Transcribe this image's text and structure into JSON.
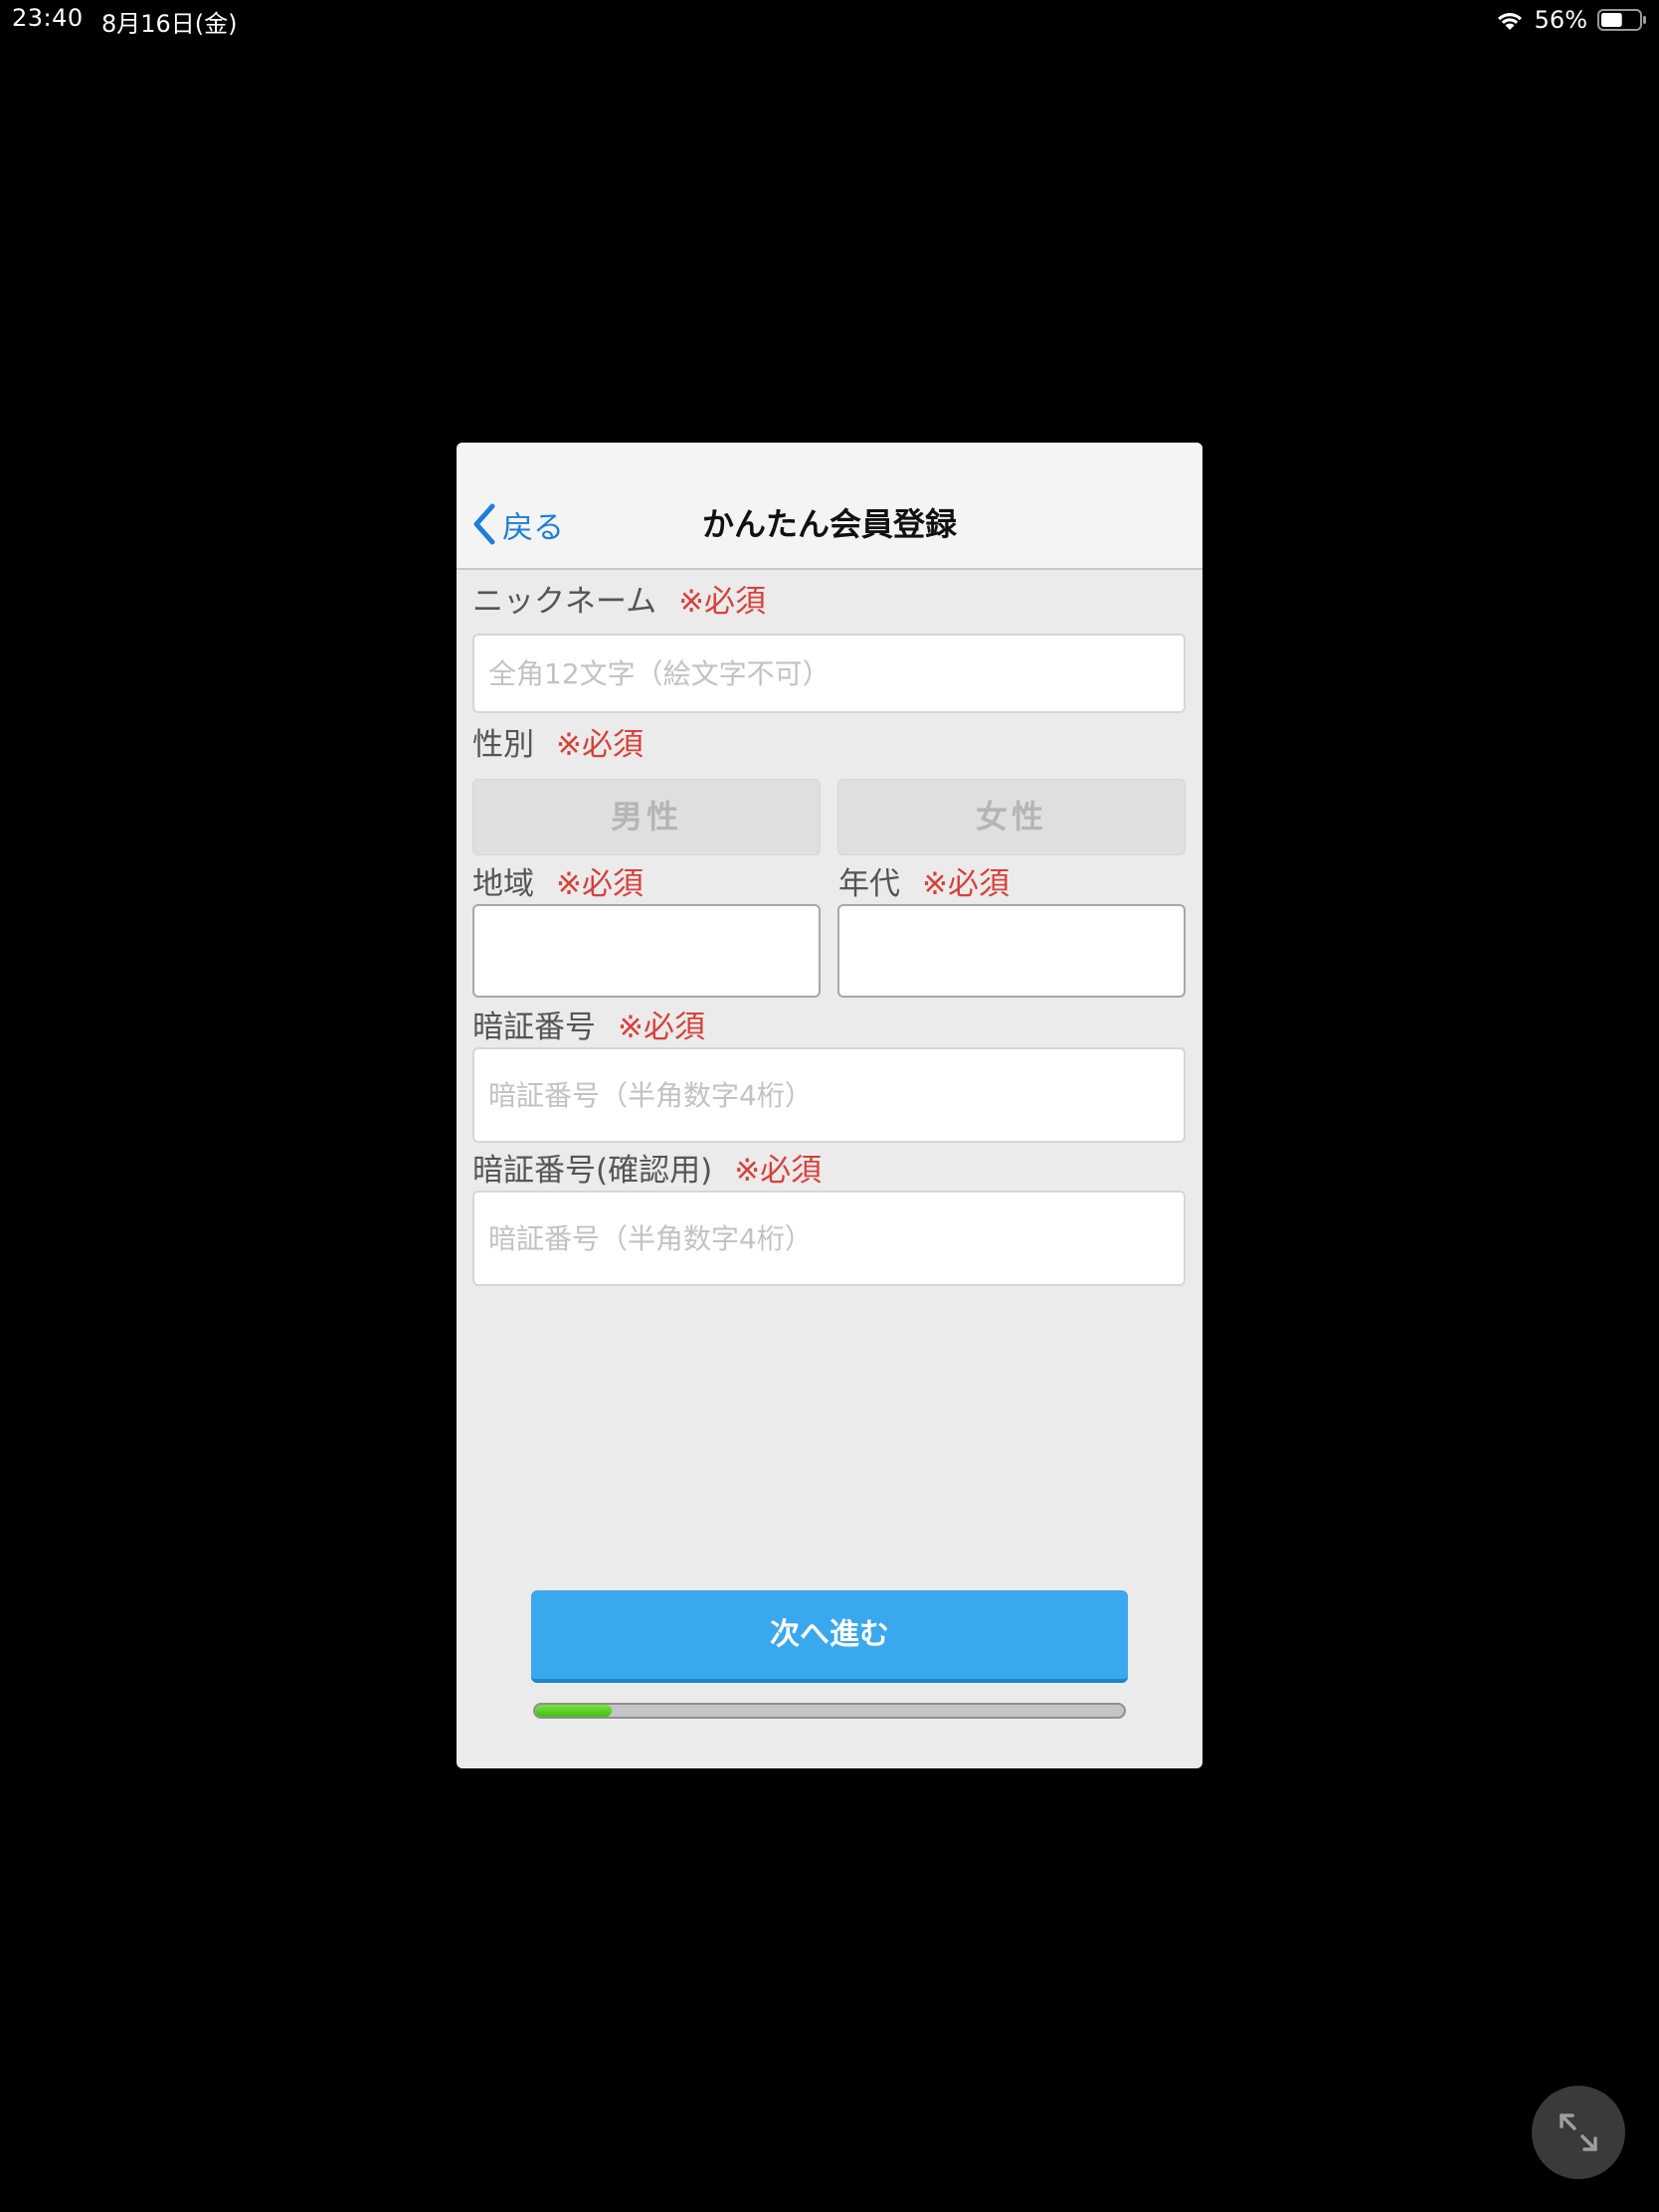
{
  "status_bar": {
    "time": "23:40",
    "date": "8月16日(金)",
    "battery_percent": "56%",
    "battery_level": 0.56,
    "icons": [
      "wifi-icon",
      "battery-icon"
    ]
  },
  "nav": {
    "back_label": "戻る",
    "title": "かんたん会員登録"
  },
  "form": {
    "nickname": {
      "label": "ニックネーム",
      "required": "※必須",
      "placeholder": "全角12文字（絵文字不可）",
      "value": ""
    },
    "gender": {
      "label": "性別",
      "required": "※必須",
      "options": [
        "男性",
        "女性"
      ],
      "selected": null
    },
    "region": {
      "label": "地域",
      "required": "※必須",
      "value": ""
    },
    "age_group": {
      "label": "年代",
      "required": "※必須",
      "value": ""
    },
    "pin": {
      "label": "暗証番号",
      "required": "※必須",
      "placeholder": "暗証番号（半角数字4桁）",
      "value": ""
    },
    "pin_confirm": {
      "label": "暗証番号(確認用)",
      "required": "※必須",
      "placeholder": "暗証番号（半角数字4桁）",
      "value": ""
    }
  },
  "actions": {
    "next_label": "次へ進む"
  },
  "progress": {
    "fraction": 0.13,
    "fill_color": "#3fbf14"
  },
  "colors": {
    "accent": "#39a8ee",
    "link": "#1d7fd8",
    "required": "#d9403a"
  },
  "expand_icon": "expand-arrows-icon"
}
